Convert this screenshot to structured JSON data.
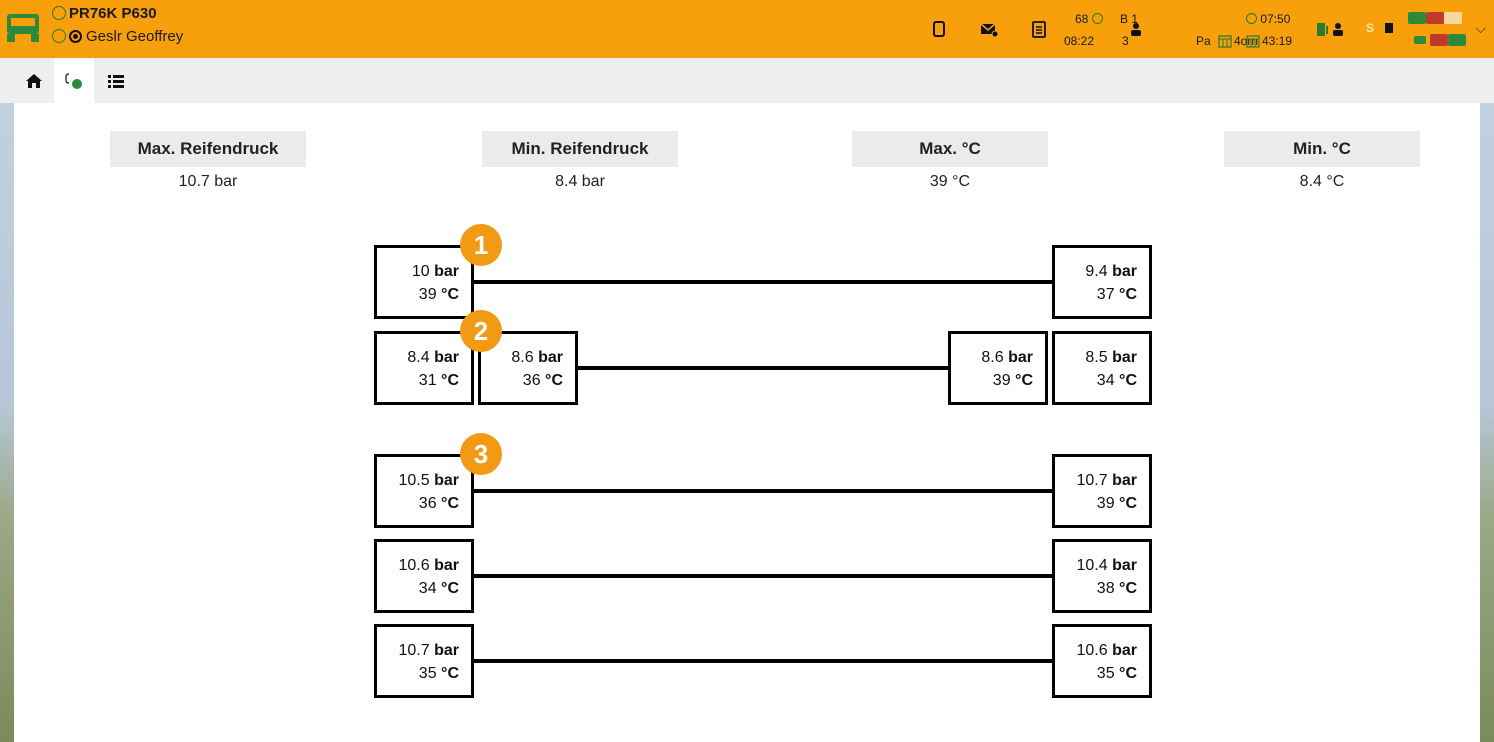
{
  "header": {
    "vehicle_id": "PR76K P630",
    "driver_name": "Geslr Geoffrey",
    "stat_speed": "68",
    "stat_time_a": "08:22",
    "stat_b": "B 1",
    "stat_b_sub": "3",
    "stat_pa": "Pa",
    "stat_date": "4orn",
    "stat_clock": "07:50",
    "stat_duration": "43:19",
    "stat_s": "S",
    "accent_color": "#f7a00c"
  },
  "nav": {
    "items": [
      {
        "icon": "home-icon"
      },
      {
        "icon": "tire-pressure-icon"
      },
      {
        "icon": "list-icon"
      }
    ]
  },
  "stats": {
    "max_pressure_label": "Max. Reifendruck",
    "max_pressure_value": "10.7 bar",
    "min_pressure_label": "Min. Reifendruck",
    "min_pressure_value": "8.4 bar",
    "max_temp_label": "Max. °C",
    "max_temp_value": "39 °C",
    "min_temp_label": "Min. °C",
    "min_temp_value": "8.4 °C"
  },
  "units": {
    "pressure": "bar",
    "temp": "°C"
  },
  "axles": [
    {
      "badge": "1",
      "tires": [
        {
          "pressure": "10",
          "temp": "39"
        },
        {
          "pressure": "9.4",
          "temp": "37"
        }
      ]
    },
    {
      "badge": "2",
      "tires": [
        {
          "pressure": "8.4",
          "temp": "31"
        },
        {
          "pressure": "8.6",
          "temp": "36"
        },
        {
          "pressure": "8.6",
          "temp": "39"
        },
        {
          "pressure": "8.5",
          "temp": "34"
        }
      ]
    },
    {
      "badge": "3",
      "tires": [
        {
          "pressure": "10.5",
          "temp": "36"
        },
        {
          "pressure": "10.7",
          "temp": "39"
        }
      ]
    },
    {
      "badge": "",
      "tires": [
        {
          "pressure": "10.6",
          "temp": "34"
        },
        {
          "pressure": "10.4",
          "temp": "38"
        }
      ]
    },
    {
      "badge": "",
      "tires": [
        {
          "pressure": "10.7",
          "temp": "35"
        },
        {
          "pressure": "10.6",
          "temp": "35"
        }
      ]
    }
  ]
}
